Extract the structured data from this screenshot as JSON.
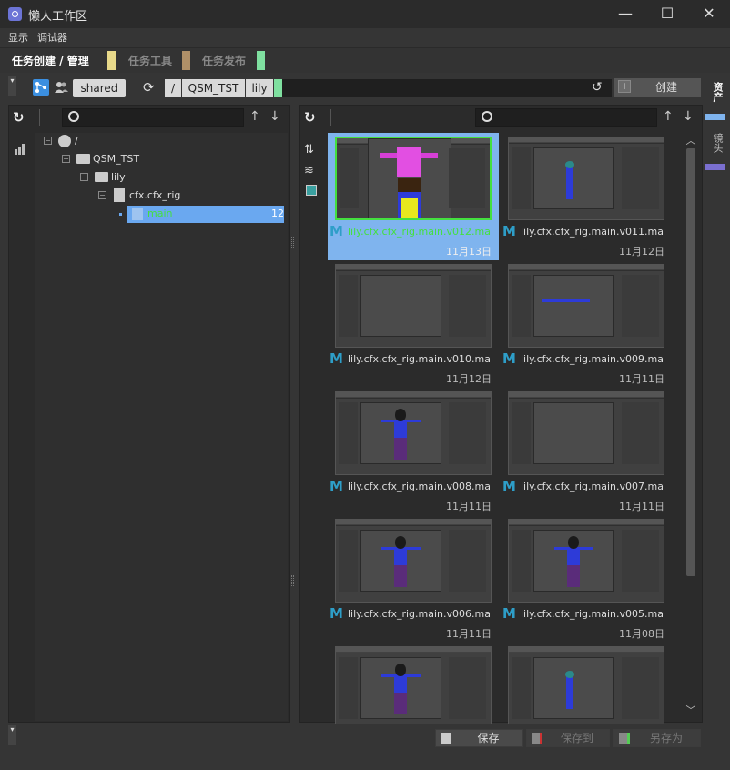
{
  "window": {
    "title": "懒人工作区",
    "controls": {
      "minimize": "—",
      "maximize": "☐",
      "close": "✕"
    }
  },
  "menu": [
    "显示",
    "调试器"
  ],
  "tabs": [
    {
      "label": "任务创建 / 管理",
      "active": true,
      "color": "#e8d98a"
    },
    {
      "label": "任务工具",
      "active": false,
      "color": "#b09068"
    },
    {
      "label": "任务发布",
      "active": false,
      "color": "#7fe0a0"
    }
  ],
  "toolbar": {
    "scope": "shared",
    "path": [
      "/",
      "QSM_TST",
      "lily"
    ],
    "create_label": "创建"
  },
  "side_tabs": [
    "资产",
    "镜头"
  ],
  "tree": {
    "nodes": [
      {
        "label": "/",
        "icon": "user-icon"
      },
      {
        "label": "QSM_TST",
        "icon": "folder-icon"
      },
      {
        "label": "lily",
        "icon": "folder-icon"
      },
      {
        "label": "cfx.cfx_rig",
        "icon": "file-icon"
      },
      {
        "label": "main",
        "icon": "version-icon",
        "count": "12",
        "selected": true
      }
    ]
  },
  "files": [
    {
      "name": "lily.cfx.cfx_rig.main.v012.ma",
      "date": "11月13日",
      "selected": true,
      "figure": "magenta"
    },
    {
      "name": "lily.cfx.cfx_rig.main.v011.ma",
      "date": "11月12日",
      "figure": "small"
    },
    {
      "name": "lily.cfx.cfx_rig.main.v010.ma",
      "date": "11月12日",
      "figure": "none"
    },
    {
      "name": "lily.cfx.cfx_rig.main.v009.ma",
      "date": "11月11日",
      "figure": "line"
    },
    {
      "name": "lily.cfx.cfx_rig.main.v008.ma",
      "date": "11月11日",
      "figure": "tpose"
    },
    {
      "name": "lily.cfx.cfx_rig.main.v007.ma",
      "date": "11月11日",
      "figure": "none"
    },
    {
      "name": "lily.cfx.cfx_rig.main.v006.ma",
      "date": "11月11日",
      "figure": "tpose"
    },
    {
      "name": "lily.cfx.cfx_rig.main.v005.ma",
      "date": "11月08日",
      "figure": "tpose"
    },
    {
      "name": "",
      "date": "",
      "figure": "tpose"
    },
    {
      "name": "",
      "date": "",
      "figure": "small"
    }
  ],
  "bottom": {
    "save": "保存",
    "save_to": "保存到",
    "save_as": "另存为"
  },
  "colors": {
    "selection": "#7fb4ee",
    "tree_selection": "#6aa8f0",
    "accent_green": "#44e03f"
  }
}
